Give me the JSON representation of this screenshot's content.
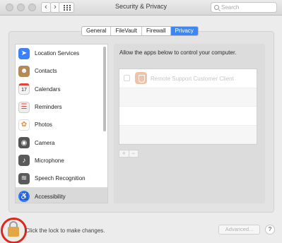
{
  "window": {
    "title": "Security & Privacy"
  },
  "toolbar": {
    "back_glyph": "‹",
    "forward_glyph": "›",
    "grid_icon": "grid-icon"
  },
  "search": {
    "placeholder": "Search"
  },
  "tabs": [
    {
      "label": "General",
      "active": false
    },
    {
      "label": "FileVault",
      "active": false
    },
    {
      "label": "Firewall",
      "active": false
    },
    {
      "label": "Privacy",
      "active": true
    }
  ],
  "sidebar": {
    "items": [
      {
        "label": "Location Services",
        "icon": "location-arrow-icon",
        "glyph": "➤",
        "color": "#3a82f7",
        "selected": false
      },
      {
        "label": "Contacts",
        "icon": "contacts-book-icon",
        "glyph": "☻",
        "color": "#b58a57",
        "selected": false
      },
      {
        "label": "Calendars",
        "icon": "calendar-icon",
        "glyph": "17",
        "color": "#f4f4f4",
        "selected": false
      },
      {
        "label": "Reminders",
        "icon": "reminders-list-icon",
        "glyph": "☰",
        "color": "#eeeeee",
        "selected": false
      },
      {
        "label": "Photos",
        "icon": "photos-flower-icon",
        "glyph": "✿",
        "color": "#f5a14a",
        "selected": false
      },
      {
        "label": "Camera",
        "icon": "camera-icon",
        "glyph": "◉",
        "color": "#555555",
        "selected": false
      },
      {
        "label": "Microphone",
        "icon": "microphone-icon",
        "glyph": "♪",
        "color": "#5a5a5a",
        "selected": false
      },
      {
        "label": "Speech Recognition",
        "icon": "speech-wave-icon",
        "glyph": "≋",
        "color": "#5a5a5a",
        "selected": false
      },
      {
        "label": "Accessibility",
        "icon": "accessibility-person-icon",
        "glyph": "♿",
        "color": "#2f7cf6",
        "selected": true
      }
    ]
  },
  "main": {
    "instruction": "Allow the apps below to control your computer.",
    "apps": [
      {
        "name": "Remote Support Customer Client",
        "checked": false,
        "icon": "remote-support-app-icon"
      }
    ],
    "add_label": "+",
    "remove_label": "−"
  },
  "footer": {
    "lock_text": "Click the lock to make changes.",
    "advanced_label": "Advanced...",
    "help_label": "?"
  },
  "colors": {
    "accent": "#3b87f4",
    "lock_highlight": "#e0261b",
    "lock_body": "#e2a645"
  }
}
